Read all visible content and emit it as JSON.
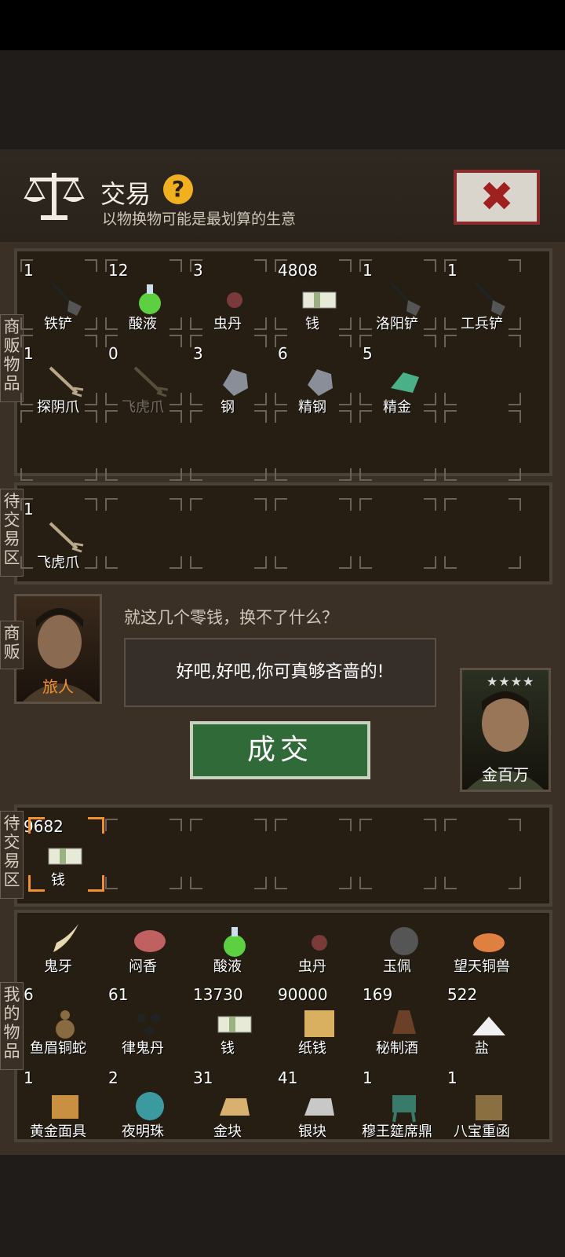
{
  "header": {
    "title": "交易",
    "subtitle": "以物换物可能是最划算的生意",
    "help": "?",
    "close": "✖"
  },
  "labels": {
    "merchant_items": "商贩物品",
    "pending_top": "待交易区",
    "merchant": "商贩",
    "pending_bottom": "待交易区",
    "my_items": "我的物品"
  },
  "merchant_items": [
    {
      "qty": "1",
      "name": "铁铲",
      "icon": "shovel-icon"
    },
    {
      "qty": "12",
      "name": "酸液",
      "icon": "flask-icon"
    },
    {
      "qty": "3",
      "name": "虫丹",
      "icon": "pill-icon"
    },
    {
      "qty": "4808",
      "name": "钱",
      "icon": "money-icon"
    },
    {
      "qty": "1",
      "name": "洛阳铲",
      "icon": "shovel-icon"
    },
    {
      "qty": "1",
      "name": "工兵铲",
      "icon": "shovel-icon"
    },
    {
      "qty": "1",
      "name": "探阴爪",
      "icon": "claw-icon"
    },
    {
      "qty": "0",
      "name": "飞虎爪",
      "icon": "claw-icon"
    },
    {
      "qty": "3",
      "name": "钢",
      "icon": "ore-icon"
    },
    {
      "qty": "6",
      "name": "精钢",
      "icon": "ore-icon"
    },
    {
      "qty": "5",
      "name": "精金",
      "icon": "gem-icon"
    }
  ],
  "pending_top": [
    {
      "qty": "1",
      "name": "飞虎爪",
      "icon": "claw-icon"
    }
  ],
  "merchant": {
    "name": "旅人",
    "line": "就这几个零钱，换不了什么？",
    "reply": "好吧,好吧,你可真够吝啬的!"
  },
  "player": {
    "name": "金百万",
    "stars": "★★★★"
  },
  "deal_button": "成交",
  "pending_bottom": [
    {
      "qty": "9682",
      "name": "钱",
      "icon": "money-icon"
    }
  ],
  "my_items_row1": [
    {
      "name": "鬼牙",
      "icon": "fang-icon"
    },
    {
      "name": "闷香",
      "icon": "meat-icon"
    },
    {
      "name": "酸液",
      "icon": "flask-icon"
    },
    {
      "name": "虫丹",
      "icon": "pill-icon"
    },
    {
      "name": "玉佩",
      "icon": "jade-icon"
    },
    {
      "name": "望天铜兽",
      "icon": "bronze-beast-icon"
    }
  ],
  "my_items": [
    {
      "qty": "6",
      "name": "鱼眉铜蛇",
      "icon": "snake-icon"
    },
    {
      "qty": "61",
      "name": "律鬼丹",
      "icon": "pills-icon"
    },
    {
      "qty": "13730",
      "name": "钱",
      "icon": "money-icon"
    },
    {
      "qty": "90000",
      "name": "纸钱",
      "icon": "paper-money-icon"
    },
    {
      "qty": "169",
      "name": "秘制酒",
      "icon": "jar-icon"
    },
    {
      "qty": "522",
      "name": "盐",
      "icon": "salt-icon"
    },
    {
      "qty": "1",
      "name": "黄金面具",
      "icon": "mask-icon"
    },
    {
      "qty": "2",
      "name": "夜明珠",
      "icon": "pearl-icon"
    },
    {
      "qty": "31",
      "name": "金块",
      "icon": "gold-icon"
    },
    {
      "qty": "41",
      "name": "银块",
      "icon": "silver-icon"
    },
    {
      "qty": "1",
      "name": "穆王筵席鼎",
      "icon": "cauldron-icon"
    },
    {
      "qty": "1",
      "name": "八宝重函",
      "icon": "chest-icon"
    }
  ]
}
